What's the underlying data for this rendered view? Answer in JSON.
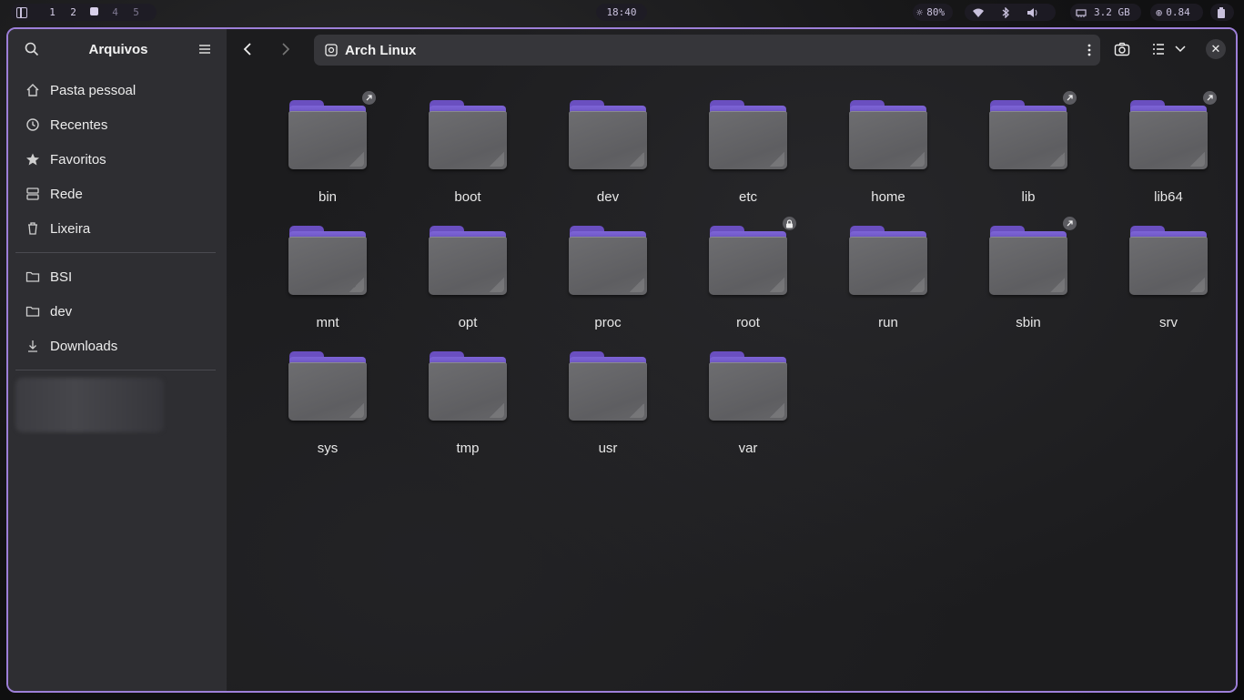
{
  "topbar": {
    "workspaces": [
      "1",
      "2",
      "",
      "4",
      "5"
    ],
    "clock": "18:40",
    "brightness": "80%",
    "memory": "3.2 GB",
    "load": "0.84",
    "accent": "#c9c1dd"
  },
  "sidebar": {
    "title": "Arquivos",
    "places": [
      {
        "label": "Pasta pessoal",
        "icon": "home-icon"
      },
      {
        "label": "Recentes",
        "icon": "clock-icon"
      },
      {
        "label": "Favoritos",
        "icon": "star-icon"
      },
      {
        "label": "Rede",
        "icon": "network-icon"
      },
      {
        "label": "Lixeira",
        "icon": "trash-icon"
      }
    ],
    "bookmarks": [
      {
        "label": "BSI",
        "icon": "folder-icon"
      },
      {
        "label": "dev",
        "icon": "folder-icon"
      },
      {
        "label": "Downloads",
        "icon": "download-icon"
      }
    ]
  },
  "header": {
    "location": "Arch Linux"
  },
  "folders": [
    {
      "name": "bin",
      "emblem": "link"
    },
    {
      "name": "boot",
      "emblem": ""
    },
    {
      "name": "dev",
      "emblem": ""
    },
    {
      "name": "etc",
      "emblem": ""
    },
    {
      "name": "home",
      "emblem": ""
    },
    {
      "name": "lib",
      "emblem": "link"
    },
    {
      "name": "lib64",
      "emblem": "link"
    },
    {
      "name": "mnt",
      "emblem": ""
    },
    {
      "name": "opt",
      "emblem": ""
    },
    {
      "name": "proc",
      "emblem": ""
    },
    {
      "name": "root",
      "emblem": "lock"
    },
    {
      "name": "run",
      "emblem": ""
    },
    {
      "name": "sbin",
      "emblem": "link"
    },
    {
      "name": "srv",
      "emblem": ""
    },
    {
      "name": "sys",
      "emblem": ""
    },
    {
      "name": "tmp",
      "emblem": ""
    },
    {
      "name": "usr",
      "emblem": ""
    },
    {
      "name": "var",
      "emblem": ""
    }
  ],
  "colors": {
    "window_border": "#9d7fd8",
    "folder_accent": "#6a4fc0",
    "sidebar_bg": "#2e2e32",
    "main_bg": "#1c1c1e"
  }
}
